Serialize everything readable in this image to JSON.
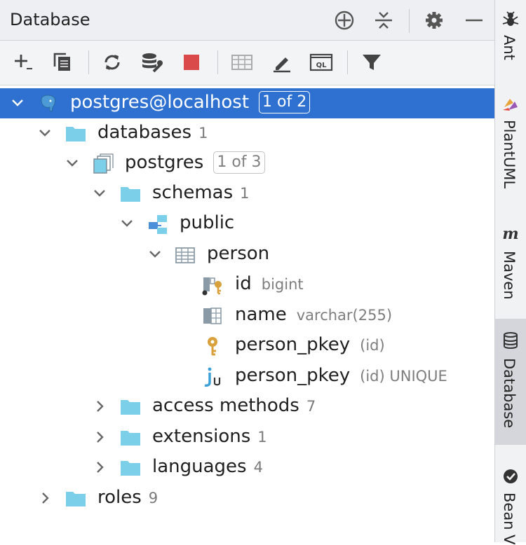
{
  "header": {
    "title": "Database"
  },
  "toolbar": {},
  "tree": {
    "root": {
      "label": "postgres@localhost",
      "badge": "1 of 2"
    },
    "databases": {
      "label": "databases",
      "count": "1"
    },
    "db_postgres": {
      "label": "postgres",
      "badge": "1 of 3"
    },
    "schemas": {
      "label": "schemas",
      "count": "1"
    },
    "public": {
      "label": "public"
    },
    "person": {
      "label": "person"
    },
    "col_id": {
      "label": "id",
      "type": "bigint"
    },
    "col_name": {
      "label": "name",
      "type": "varchar(255)"
    },
    "key_pkey": {
      "label": "person_pkey",
      "type": "(id)"
    },
    "index_pkey": {
      "label": "person_pkey",
      "type": "(id) UNIQUE"
    },
    "access_methods": {
      "label": "access methods",
      "count": "7"
    },
    "extensions": {
      "label": "extensions",
      "count": "1"
    },
    "languages": {
      "label": "languages",
      "count": "4"
    },
    "roles": {
      "label": "roles",
      "count": "9"
    }
  },
  "sidebar": {
    "tabs": [
      {
        "label": "Ant",
        "icon": "ant-icon"
      },
      {
        "label": "PlantUML",
        "icon": "plantuml-icon"
      },
      {
        "label": "Maven",
        "icon": "maven-icon"
      },
      {
        "label": "Database",
        "icon": "database-icon",
        "active": true
      },
      {
        "label": "Bean V",
        "icon": "bean-icon"
      }
    ]
  },
  "colors": {
    "selection": "#2f71d0",
    "folder": "#7ccfe8",
    "key": "#d9a13b",
    "stop": "#db4a4a"
  }
}
